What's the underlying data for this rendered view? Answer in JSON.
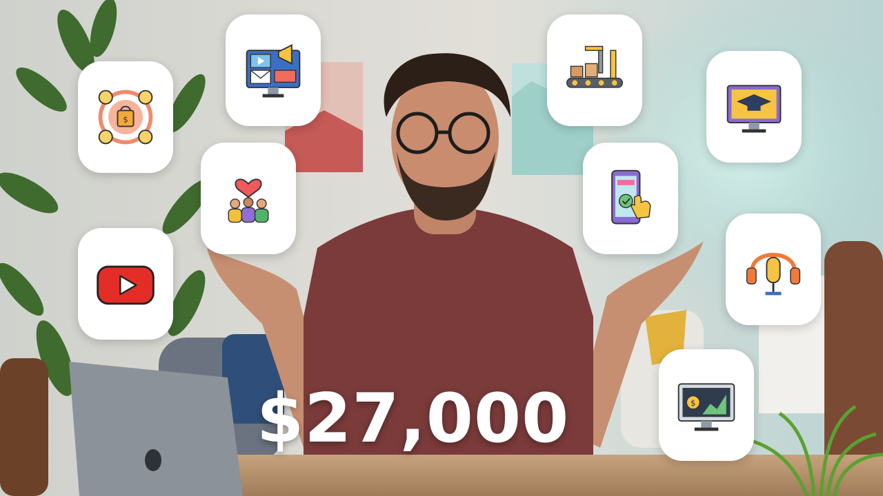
{
  "headline": {
    "amount": "$27,000"
  },
  "icons": [
    {
      "name": "affiliate-shopping-network-icon"
    },
    {
      "name": "digital-marketing-monitor-icon"
    },
    {
      "name": "audience-community-heart-icon"
    },
    {
      "name": "youtube-play-icon"
    },
    {
      "name": "factory-conveyor-icon"
    },
    {
      "name": "online-course-graduation-icon"
    },
    {
      "name": "mobile-app-tap-icon"
    },
    {
      "name": "podcast-microphone-icon"
    },
    {
      "name": "trading-chart-monitor-icon"
    }
  ],
  "colors": {
    "wall": "#d9d6d0",
    "shirt": "#7a3b3a",
    "desk": "#b89472",
    "youtube_red": "#e52d27",
    "tile": "#ffffff"
  }
}
